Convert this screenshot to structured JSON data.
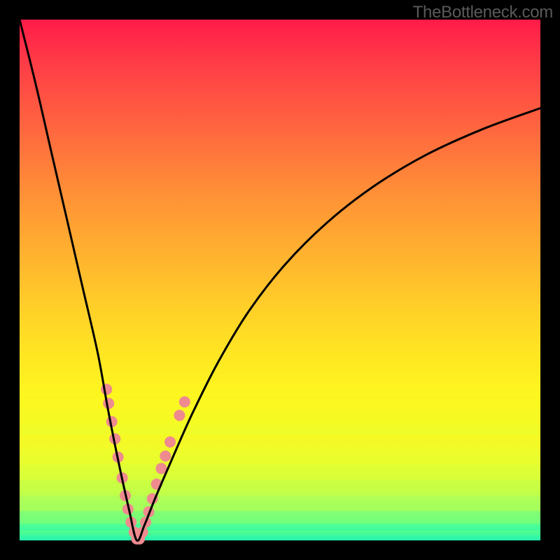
{
  "watermark": "TheBottleneck.com",
  "chart_data": {
    "type": "line",
    "title": "",
    "xlabel": "",
    "ylabel": "",
    "xlim": [
      0,
      100
    ],
    "ylim": [
      0,
      100
    ],
    "legend": false,
    "grid": false,
    "axes_visible": false,
    "background_gradient": {
      "top": "#ff1b49",
      "mid": "#ffe822",
      "bottom": "#22f2b2"
    },
    "series": [
      {
        "name": "bottleneck-curve",
        "color": "#000000",
        "x": [
          0,
          3,
          6,
          9,
          12,
          15,
          17,
          19,
          21,
          22.5,
          24,
          26,
          29,
          33,
          38,
          44,
          51,
          59,
          68,
          78,
          89,
          100
        ],
        "y": [
          100,
          88,
          75,
          62,
          49,
          36,
          25,
          15,
          6,
          0,
          3,
          8,
          15,
          24,
          34,
          44,
          53,
          61,
          68,
          74,
          79,
          83
        ]
      }
    ],
    "markers": [
      {
        "name": "highlight-dots",
        "color": "#ef8a8f",
        "radius_px": 8,
        "points": [
          {
            "x": 16.7,
            "y": 29.0
          },
          {
            "x": 17.1,
            "y": 26.3
          },
          {
            "x": 17.7,
            "y": 22.8
          },
          {
            "x": 18.3,
            "y": 19.5
          },
          {
            "x": 18.9,
            "y": 16.0
          },
          {
            "x": 19.7,
            "y": 12.0
          },
          {
            "x": 20.3,
            "y": 8.6
          },
          {
            "x": 20.8,
            "y": 6.0
          },
          {
            "x": 21.4,
            "y": 3.5
          },
          {
            "x": 22.0,
            "y": 1.6
          },
          {
            "x": 22.5,
            "y": 0.3
          },
          {
            "x": 23.0,
            "y": 0.3
          },
          {
            "x": 23.6,
            "y": 1.6
          },
          {
            "x": 24.2,
            "y": 3.5
          },
          {
            "x": 24.8,
            "y": 5.5
          },
          {
            "x": 25.5,
            "y": 8.0
          },
          {
            "x": 26.3,
            "y": 10.8
          },
          {
            "x": 27.2,
            "y": 13.8
          },
          {
            "x": 28.0,
            "y": 16.2
          },
          {
            "x": 28.9,
            "y": 18.9
          },
          {
            "x": 30.7,
            "y": 24.0
          },
          {
            "x": 31.7,
            "y": 26.6
          }
        ]
      }
    ]
  }
}
